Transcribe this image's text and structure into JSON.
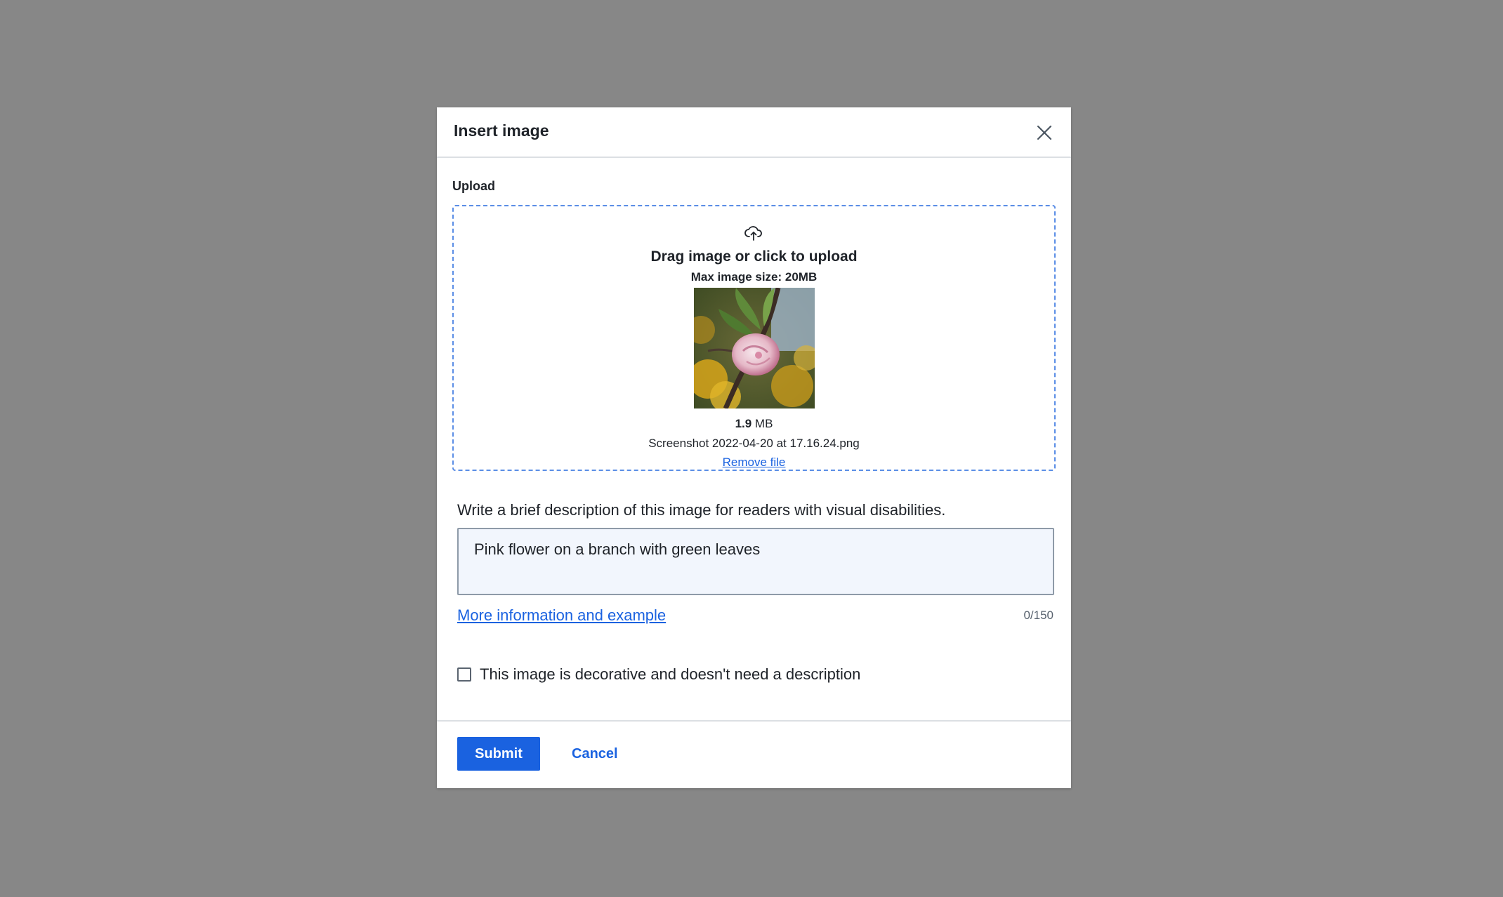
{
  "modal": {
    "title": "Insert image",
    "close_icon": "close-icon"
  },
  "upload": {
    "label": "Upload",
    "icon": "cloud-upload-icon",
    "drag_text": "Drag image or click to upload",
    "max_size": "Max image size: 20MB",
    "file": {
      "size_value": "1.9",
      "size_unit": " MB",
      "name": "Screenshot 2022-04-20 at 17.16.24.png",
      "remove_label": "Remove file"
    }
  },
  "description": {
    "label": "Write a brief description of this image for readers with visual disabilities.",
    "value": "Pink flower on a branch with green leaves",
    "more_info_label": "More information and example",
    "char_count": "0/150"
  },
  "decorative": {
    "label": "This image is decorative and doesn't need a description",
    "checked": false
  },
  "footer": {
    "submit_label": "Submit",
    "cancel_label": "Cancel"
  },
  "colors": {
    "accent": "#1a62e0",
    "backdrop": "#878787",
    "input_bg": "#f2f6fd"
  }
}
